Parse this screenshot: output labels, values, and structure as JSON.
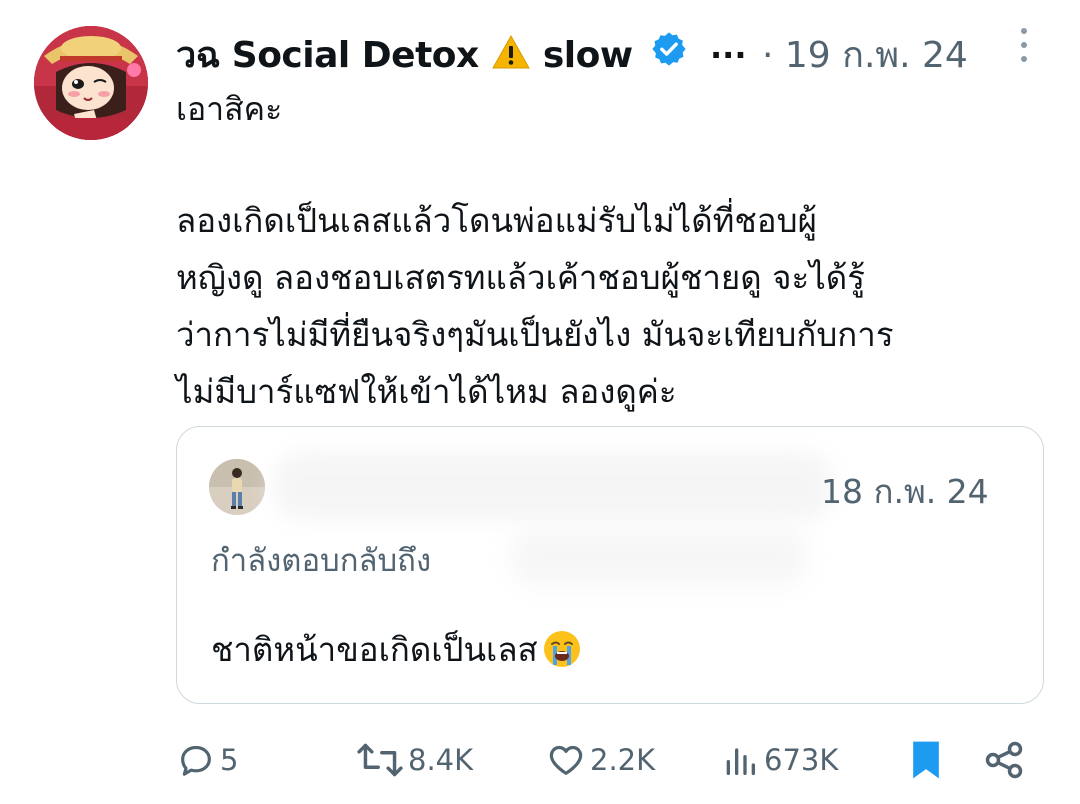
{
  "post": {
    "author_name": "วฉ Social Detox",
    "author_name_suffix": "slow",
    "warning_emoji": "⚠️",
    "name_ellipsis": "...",
    "time_separator": "·",
    "timestamp": "19 ก.พ. 24",
    "handle_line": "เอาสิคะ",
    "body_lines": [
      "ลองเกิดเป็นเลสแล้วโดนพ่อแม่รับไม่ได้ที่ชอบผู้",
      "หญิงดู ลองชอบเสตรทแล้วเค้าชอบผู้ชายดู จะได้รู้",
      "ว่าการไม่มีที่ยืนจริงๆมันเป็นยังไง มันจะเทียบกับการ",
      "ไม่มีบาร์แซฟให้เข้าได้ไหม ลองดูค่ะ"
    ]
  },
  "quote": {
    "timestamp": "18 ก.พ. 24",
    "replying_to": "กำลังตอบกลับถึง",
    "text": "ชาติหน้าขอเกิดเป็นเลส",
    "emoji": "😭"
  },
  "actions": {
    "replies": "5",
    "reposts": "8.4K",
    "likes": "2.2K",
    "views": "673K"
  },
  "colors": {
    "accent": "#1d9bf0",
    "muted": "#536471",
    "text": "#0f1419",
    "border": "#cfd9de"
  }
}
